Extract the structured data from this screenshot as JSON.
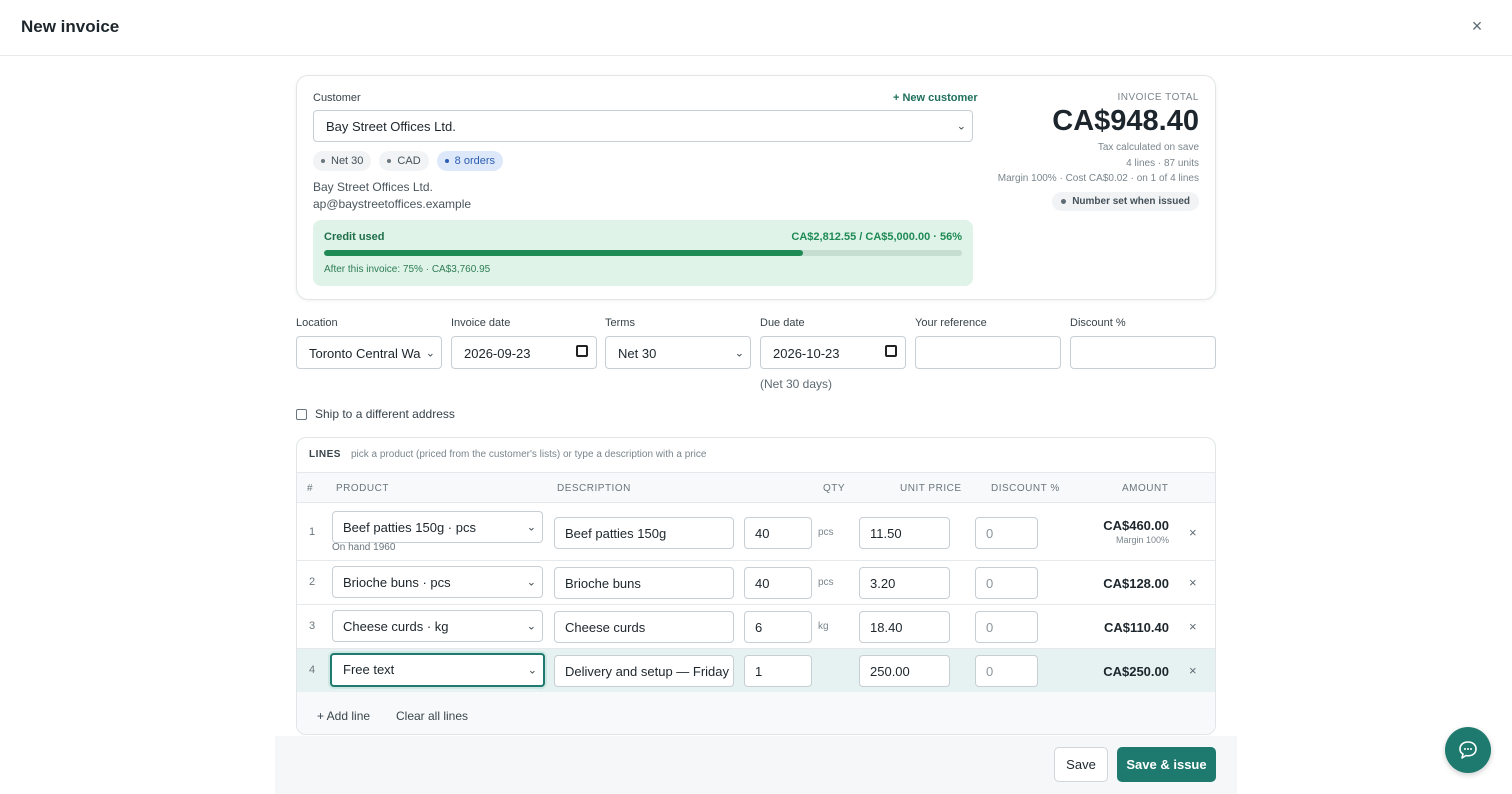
{
  "header": {
    "title": "New invoice",
    "close_icon": "×"
  },
  "customer": {
    "label": "Customer",
    "new_customer": "+ New customer",
    "selected": "Bay Street Offices Ltd.",
    "tags": [
      "Net 30",
      "CAD",
      "8 orders"
    ],
    "name": "Bay Street Offices Ltd.",
    "email": "ap@baystreetoffices.example"
  },
  "credit": {
    "label": "Credit used",
    "amount": "CA$2,812.55 / CA$5,000.00 · 56%",
    "after": "After this invoice: 75% · CA$3,760.95",
    "fill_percent": 75
  },
  "total": {
    "label": "INVOICE TOTAL",
    "value": "CA$948.40",
    "tax_note": "Tax calculated on save",
    "lines_units": "4 lines · 87 units",
    "margin": "Margin 100% · Cost CA$0.02 · on 1 of 4 lines",
    "number_badge": "Number set when issued"
  },
  "fields": {
    "location_label": "Location",
    "location_value": "Toronto Central Wa",
    "invoice_date_label": "Invoice date",
    "invoice_date_value": "2026-09-23",
    "terms_label": "Terms",
    "terms_value": "Net 30",
    "due_date_label": "Due date",
    "due_date_value": "2026-10-23",
    "due_note": "(Net 30 days)",
    "reference_label": "Your reference",
    "reference_value": "",
    "discount_label": "Discount %",
    "discount_value": ""
  },
  "ship": {
    "label": "Ship to a different address"
  },
  "lines": {
    "title": "LINES",
    "hint": "pick a product (priced from the customer's lists) or type a description with a price",
    "columns": [
      "#",
      "PRODUCT",
      "DESCRIPTION",
      "QTY",
      "UNIT PRICE",
      "DISCOUNT %",
      "AMOUNT"
    ],
    "rows": [
      {
        "num": "1",
        "product": "Beef patties 150g · pcs",
        "onhand": "On hand 1960",
        "description": "Beef patties 150g",
        "qty": "40",
        "unit": "pcs",
        "price": "11.50",
        "discount": "0",
        "amount": "CA$460.00",
        "margin": "Margin 100%"
      },
      {
        "num": "2",
        "product": "Brioche buns · pcs",
        "onhand": "",
        "description": "Brioche buns",
        "qty": "40",
        "unit": "pcs",
        "price": "3.20",
        "discount": "0",
        "amount": "CA$128.00",
        "margin": ""
      },
      {
        "num": "3",
        "product": "Cheese curds · kg",
        "onhand": "",
        "description": "Cheese curds",
        "qty": "6",
        "unit": "kg",
        "price": "18.40",
        "discount": "0",
        "amount": "CA$110.40",
        "margin": ""
      },
      {
        "num": "4",
        "product": "Free text",
        "onhand": "",
        "description": "Delivery and setup — Friday ev",
        "qty": "1",
        "unit": "",
        "price": "250.00",
        "discount": "0",
        "amount": "CA$250.00",
        "margin": ""
      }
    ],
    "add_line": "+ Add line",
    "clear_lines": "Clear all lines",
    "remove_icon": "×"
  },
  "footer": {
    "save": "Save",
    "save_issue": "Save & issue"
  },
  "icons": {
    "chat": "chat-bubble-icon",
    "chevron": "chevron-down-icon",
    "calendar": "calendar-icon"
  },
  "colors": {
    "accent": "#1e7a6f",
    "credit_bg": "#dff3e8",
    "credit_fill": "#1f8a55"
  }
}
